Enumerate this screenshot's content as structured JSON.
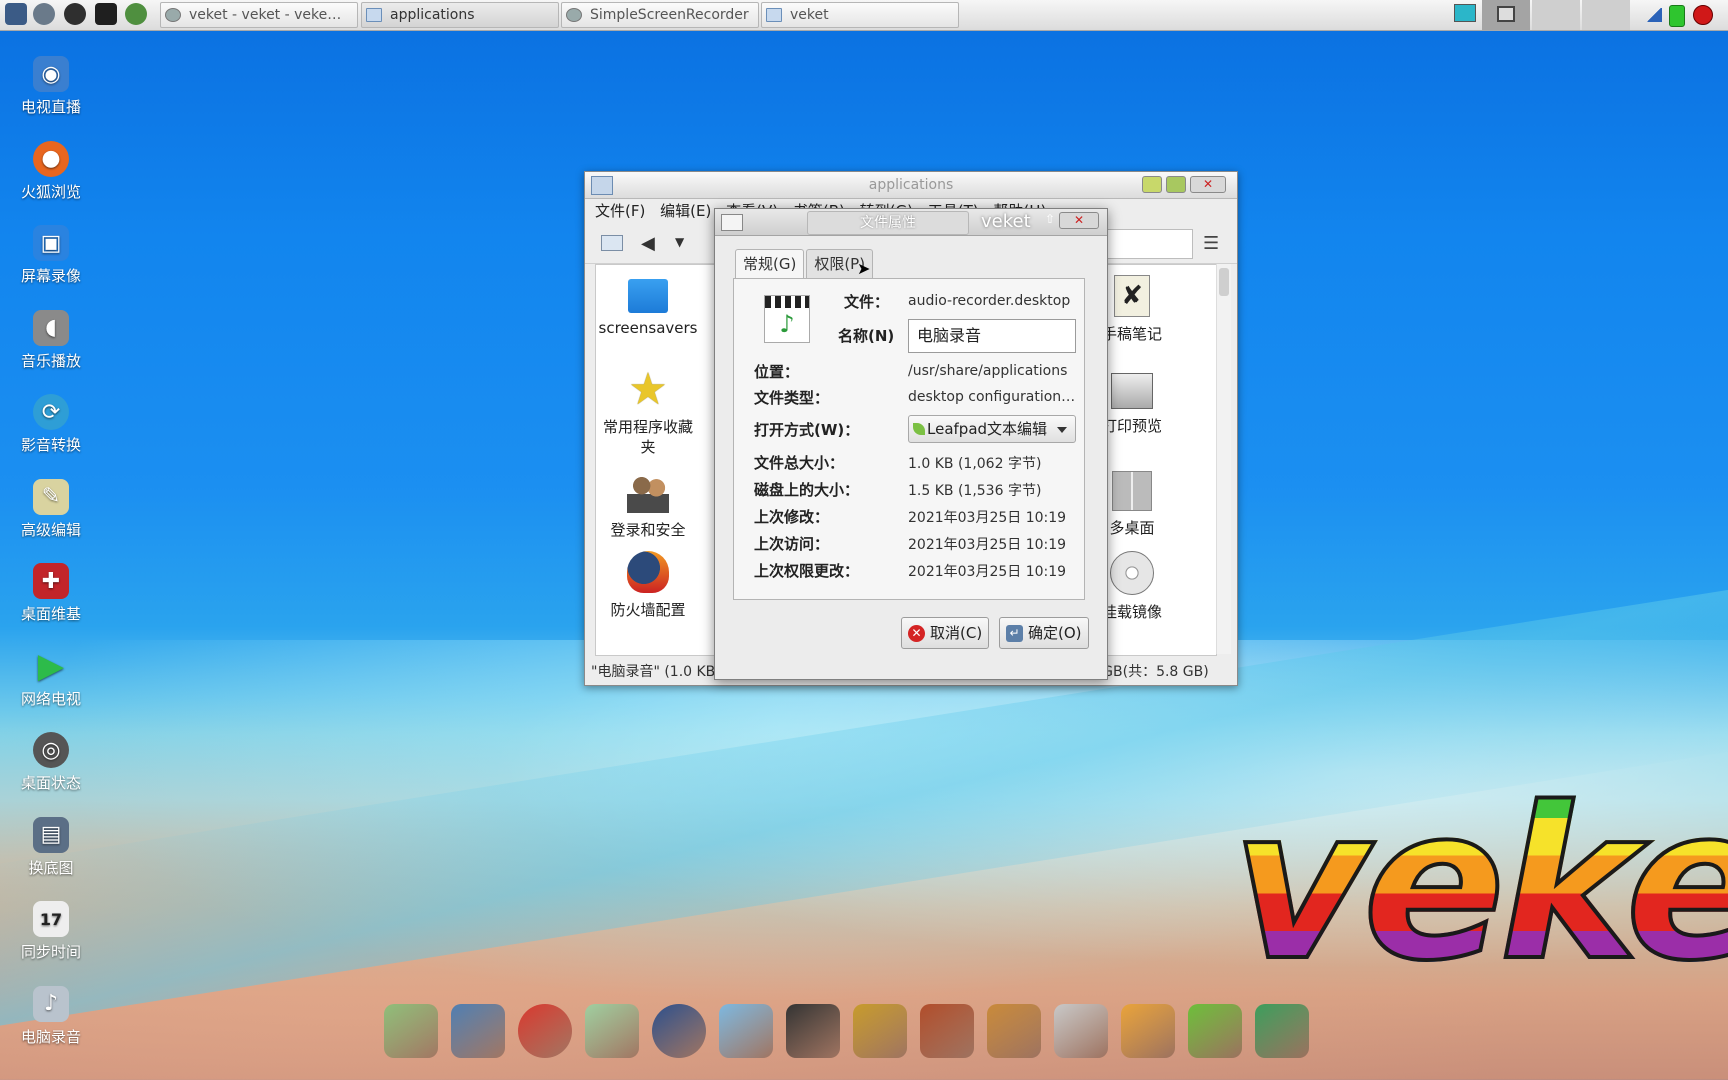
{
  "taskbar": {
    "tasks": [
      {
        "label": "veket - veket - veke…"
      },
      {
        "label": "applications"
      },
      {
        "label": "SimpleScreenRecorder"
      },
      {
        "label": "veket"
      }
    ]
  },
  "desktop": {
    "icons": [
      {
        "label": "电视直播",
        "icon": "tv-icon",
        "color": "#3a7fd0"
      },
      {
        "label": "火狐浏览",
        "icon": "firefox-icon",
        "color": "#e8661f"
      },
      {
        "label": "屏幕录像",
        "icon": "screen-record-icon",
        "color": "#2a83e0"
      },
      {
        "label": "音乐播放",
        "icon": "speaker-icon",
        "color": "#8a8a8a"
      },
      {
        "label": "影音转换",
        "icon": "media-convert-icon",
        "color": "#2e9ed6"
      },
      {
        "label": "高级编辑",
        "icon": "editor-icon",
        "color": "#d9d3a0"
      },
      {
        "label": "桌面维基",
        "icon": "tools-icon",
        "color": "#c2252a"
      },
      {
        "label": "网络电视",
        "icon": "play-icon",
        "color": "#2dbb4a"
      },
      {
        "label": "桌面状态",
        "icon": "status-icon",
        "color": "#555555"
      },
      {
        "label": "换底图",
        "icon": "wallpaper-icon",
        "color": "#5b6f86"
      },
      {
        "label": "同步时间",
        "icon": "calendar-icon",
        "color": "#eeeeee"
      },
      {
        "label": "电脑录音",
        "icon": "microphone-icon",
        "color": "#b9c3cd"
      }
    ]
  },
  "app_window": {
    "title": "applications",
    "menu": [
      "文件(F)",
      "编辑(E)",
      "查看(V)",
      "书签(B)",
      "转到(G)",
      "工具(T)",
      "帮助(H)"
    ],
    "files_left": [
      {
        "label": "screensavers",
        "icon": "folder-icon"
      },
      {
        "label": "常用程序收藏夹",
        "icon": "star-icon"
      },
      {
        "label": "登录和安全",
        "icon": "users-icon"
      },
      {
        "label": "防火墙配置",
        "icon": "firewall-icon"
      }
    ],
    "files_right": [
      {
        "label": "手稿笔记",
        "icon": "notes-icon"
      },
      {
        "label": "打印预览",
        "icon": "print-preview-icon"
      },
      {
        "label": "多桌面",
        "icon": "desktops-icon"
      },
      {
        "label": "挂载镜像",
        "icon": "disc-icon"
      }
    ],
    "status": "\"电脑录音\" (1.0 KB) desktop configuration file",
    "status_right": "可用空间： 3.1 GB(共：5.8 GB)"
  },
  "dialog": {
    "title": "文件属性",
    "brand": "veket",
    "tabs": [
      "常规(G)",
      "权限(P)"
    ],
    "file_label": "文件：",
    "file_value": "audio-recorder.desktop",
    "name_label": "名称(N)",
    "name_value": "电脑录音",
    "location_label": "位置：",
    "location_value": "/usr/share/applications",
    "type_label": "文件类型：",
    "type_value": "desktop configuration…",
    "open_label": "打开方式(W)：",
    "open_value": "Leafpad文本编辑",
    "size_label": "文件总大小：",
    "size_value": "1.0 KB (1,062 字节)",
    "disk_label": "磁盘上的大小：",
    "disk_value": "1.5 KB (1,536 字节)",
    "modified_label": "上次修改：",
    "modified_value": "2021年03月25日  10:19",
    "accessed_label": "上次访问：",
    "accessed_value": "2021年03月25日  10:19",
    "perm_label": "上次权限更改：",
    "perm_value": "2021年03月25日  10:19",
    "cancel": "取消(C)",
    "ok": "确定(O)"
  },
  "logo_text": "veke",
  "dock": [
    {
      "icon": "file-manager-icon",
      "color": "#8fbf7a"
    },
    {
      "icon": "monitor-icon",
      "color": "#4f7fb3"
    },
    {
      "icon": "fox-icon",
      "color": "#d9382e"
    },
    {
      "icon": "notepad-icon",
      "color": "#9fcfa0"
    },
    {
      "icon": "media-player-icon",
      "color": "#2c4f8c"
    },
    {
      "icon": "chat-icon",
      "color": "#7db8e0"
    },
    {
      "icon": "qq-penguin-icon",
      "color": "#333333"
    },
    {
      "icon": "book-icon",
      "color": "#c79b2c"
    },
    {
      "icon": "slides-icon",
      "color": "#b14d2b"
    },
    {
      "icon": "paint-icon",
      "color": "#c98a3a"
    },
    {
      "icon": "usb-icon",
      "color": "#c8c8c8"
    },
    {
      "icon": "veket-app-icon",
      "color": "#e9a33a"
    },
    {
      "icon": "help-icon",
      "color": "#6cbf3a"
    },
    {
      "icon": "camera-icon",
      "color": "#3b9e5c"
    }
  ]
}
